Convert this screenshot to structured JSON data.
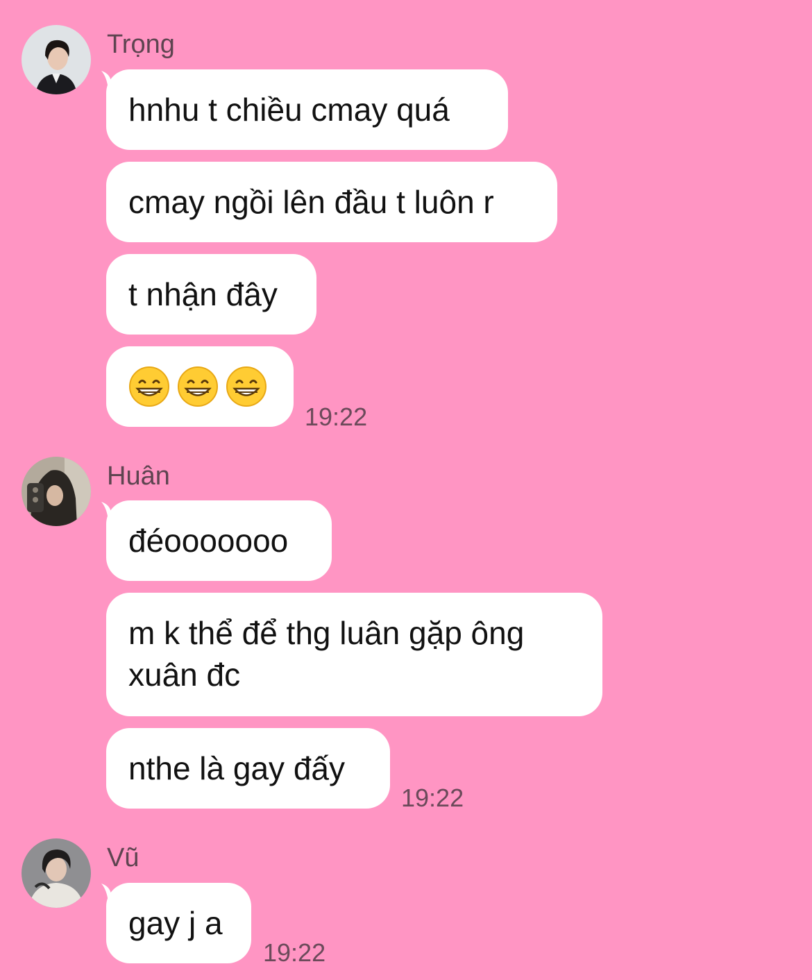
{
  "chat": {
    "groups": [
      {
        "sender": "Trọng",
        "messages": [
          "hnhu t chiều cmay quá",
          "cmay ngồi lên đầu t luôn r",
          "t nhận đây"
        ],
        "emoji_message": {
          "icon": "grinning-face-emoji",
          "count": 3
        },
        "time": "19:22"
      },
      {
        "sender": "Huân",
        "messages": [
          "đéooooooo",
          "m k thể để thg luân gặp ông xuân đc",
          "nthe là gay đấy"
        ],
        "time": "19:22"
      },
      {
        "sender": "Vũ",
        "messages": [
          "gay j a"
        ],
        "time": "19:22"
      }
    ]
  },
  "colors": {
    "background": "#ff95c3",
    "bubble": "#ffffff",
    "sender_name": "#5e4450",
    "timestamp": "#6b4a5a"
  }
}
